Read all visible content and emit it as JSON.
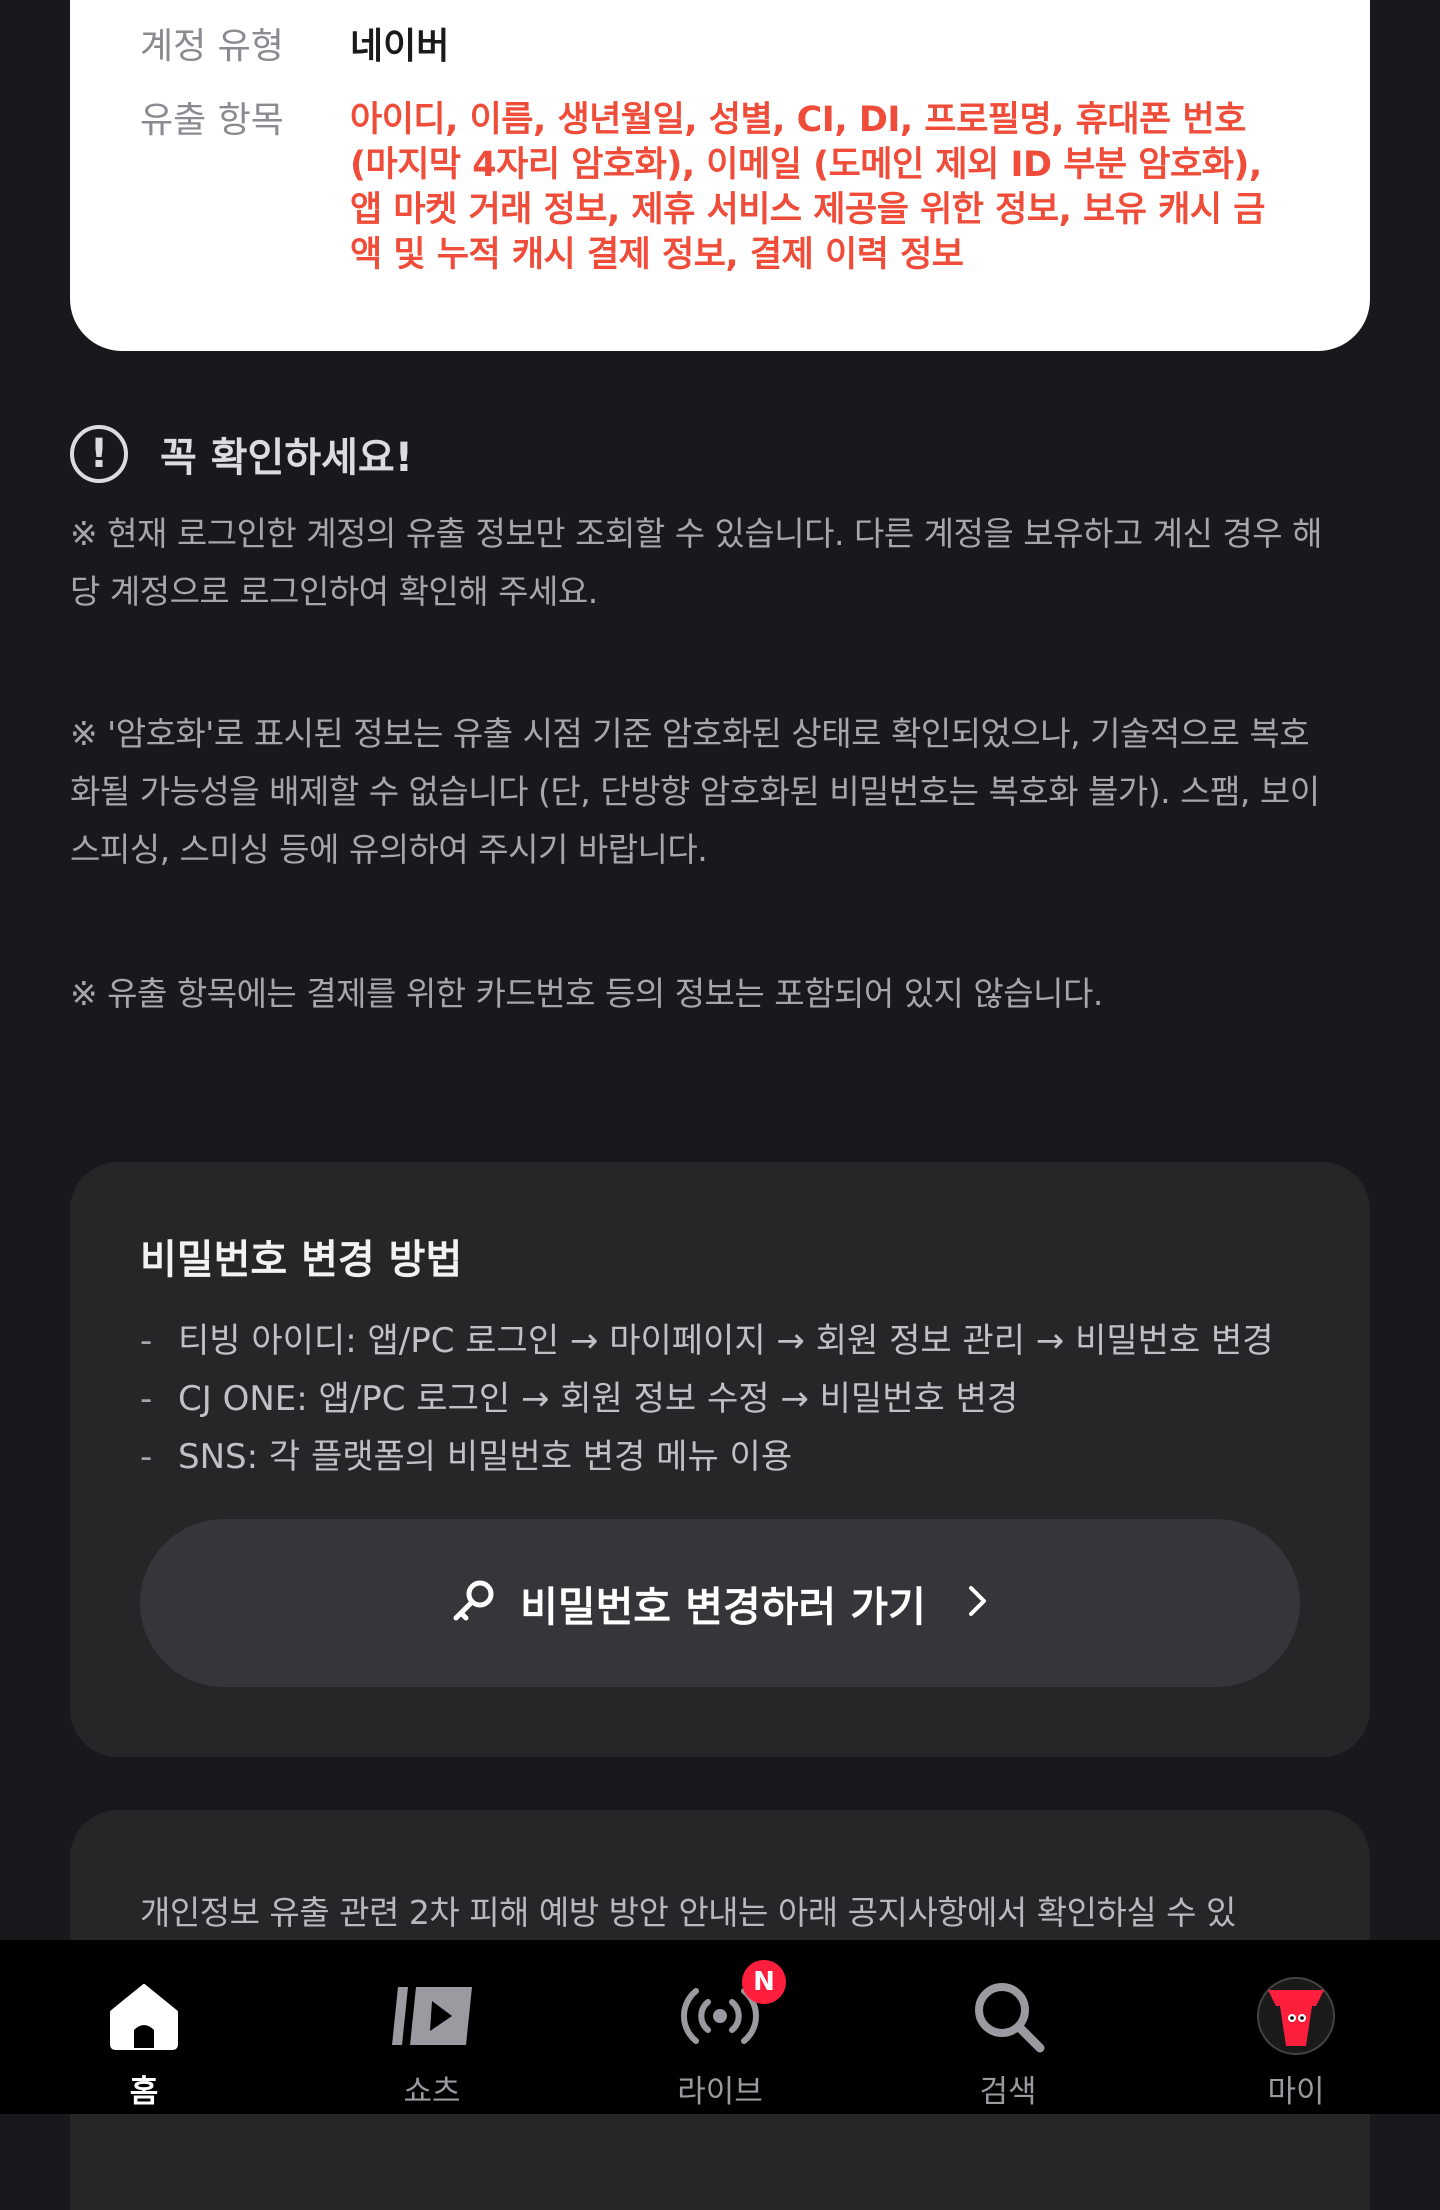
{
  "leak_card": {
    "account_type_label": "계정 유형",
    "account_type_value": "네이버",
    "leak_items_label": "유출 항목",
    "leak_items_lines": [
      "아이디, 이름, 생년월일, 성별, CI, DI, 프로필명, 휴대폰 번호",
      "(마지막 4자리 암호화), 이메일 (도메인 제외 ID 부분 암호화),",
      "앱 마켓 거래 정보, 제휴 서비스 제공을 위한 정보, 보유 캐시 금",
      "액 및 누적 캐시 결제 정보, 결제 이력 정보"
    ]
  },
  "notice": {
    "icon": "!",
    "title": "꼭 확인하세요!",
    "p1_lines": [
      "※ 현재 로그인한 계정의 유출 정보만 조회할 수 있습니다. 다른 계정을 보유하고 계신 경우 해",
      "당 계정으로 로그인하여 확인해 주세요."
    ],
    "p2_lines": [
      "※ '암호화'로 표시된 정보는 유출 시점 기준 암호화된 상태로 확인되었으나, 기술적으로 복호",
      "화될 가능성을 배제할 수 없습니다 (단, 단방향 암호화된 비밀번호는 복호화 불가). 스팸, 보이",
      "스피싱, 스미싱 등에 유의하여 주시기 바랍니다."
    ],
    "p3": "※ 유출 항목에는 결제를 위한 카드번호 등의 정보는 포함되어 있지 않습니다."
  },
  "password_card": {
    "title": "비밀번호 변경 방법",
    "dash": "-",
    "items": [
      "티빙 아이디: 앱/PC 로그인 → 마이페이지 → 회원 정보 관리 → 비밀번호 변경",
      "CJ ONE: 앱/PC 로그인 → 회원 정보 수정 → 비밀번호 변경",
      "SNS: 각 플랫폼의 비밀번호 변경 메뉴 이용"
    ],
    "button_label": "비밀번호 변경하러 가기",
    "button_icon": "key-icon"
  },
  "info_card": {
    "text": "개인정보 유출 관련 2차 피해 예방 방안 안내는 아래 공지사항에서 확인하실 수 있"
  },
  "tabbar": {
    "tabs": [
      {
        "label": "홈",
        "icon": "home-icon",
        "active": true
      },
      {
        "label": "쇼츠",
        "icon": "shorts-icon",
        "active": false
      },
      {
        "label": "라이브",
        "icon": "live-icon",
        "active": false,
        "badge": "N"
      },
      {
        "label": "검색",
        "icon": "search-icon",
        "active": false
      },
      {
        "label": "마이",
        "icon": "profile-avatar-icon",
        "active": false
      }
    ]
  },
  "colors": {
    "background": "#19191d",
    "card_dark": "#262629",
    "accent_red": "#ef4d3a",
    "badge_red": "#ff1f3d"
  }
}
